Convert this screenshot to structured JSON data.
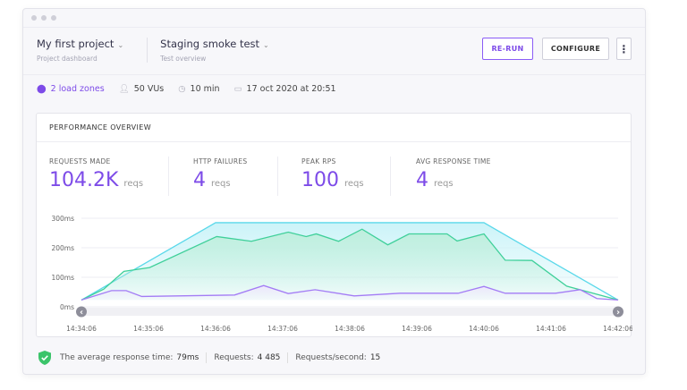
{
  "header": {
    "project": "My first project",
    "project_sub": "Project dashboard",
    "test": "Staging smoke test",
    "test_sub": "Test overview",
    "rerun": "RE-RUN",
    "configure": "CONFIGURE",
    "more": "⋮"
  },
  "meta": {
    "zones": "2 load zones",
    "vus": "50 VUs",
    "duration": "10 min",
    "date": "17 oct 2020 at 20:51"
  },
  "card": {
    "title": "PERFORMANCE OVERVIEW",
    "stats": [
      {
        "label": "REQUESTS MADE",
        "value": "104.2K",
        "unit": "reqs"
      },
      {
        "label": "HTTP FAILURES",
        "value": "4",
        "unit": "reqs"
      },
      {
        "label": "PEAK RPS",
        "value": "100",
        "unit": "reqs"
      },
      {
        "label": "AVG RESPONSE TIME",
        "value": "4",
        "unit": "reqs"
      }
    ]
  },
  "chart_data": {
    "type": "area",
    "ylim": [
      0,
      300
    ],
    "yticks": [
      "0ms",
      "100ms",
      "200ms",
      "300ms"
    ],
    "ytick_values": [
      0,
      100,
      200,
      300
    ],
    "xticks": [
      "14:34:06",
      "14:35:06",
      "14:36:06",
      "14:37:06",
      "14:38:06",
      "14:39:06",
      "14:40:06",
      "14:41:06",
      "14:42:06"
    ],
    "grid": true,
    "series": [
      {
        "color": "#5ad8ea",
        "fill": "#c9f3f8",
        "points": [
          [
            "14:34:06",
            23
          ],
          [
            "14:36:06",
            285
          ],
          [
            "14:40:06",
            285
          ],
          [
            "14:42:06",
            23
          ]
        ]
      },
      {
        "color": "#3fd09a",
        "fill": "#bdeedb",
        "points": [
          [
            "14:34:06",
            23
          ],
          [
            "14:34:26",
            60
          ],
          [
            "14:34:44",
            120
          ],
          [
            "14:35:07",
            133
          ],
          [
            "14:36:07",
            238
          ],
          [
            "14:36:38",
            222
          ],
          [
            "14:37:11",
            253
          ],
          [
            "14:37:27",
            238
          ],
          [
            "14:37:36",
            247
          ],
          [
            "14:37:56",
            222
          ],
          [
            "14:38:17",
            263
          ],
          [
            "14:38:40",
            210
          ],
          [
            "14:38:59",
            247
          ],
          [
            "14:39:33",
            247
          ],
          [
            "14:39:42",
            223
          ],
          [
            "14:40:06",
            247
          ],
          [
            "14:40:25",
            158
          ],
          [
            "14:40:49",
            157
          ],
          [
            "14:41:20",
            70
          ],
          [
            "14:42:06",
            23
          ]
        ]
      },
      {
        "color": "#a37cf5",
        "fill": "#efe7fd",
        "points": [
          [
            "14:34:06",
            23
          ],
          [
            "14:34:33",
            55
          ],
          [
            "14:34:46",
            55
          ],
          [
            "14:35:00",
            35
          ],
          [
            "14:36:23",
            40
          ],
          [
            "14:36:49",
            72
          ],
          [
            "14:37:11",
            45
          ],
          [
            "14:37:35",
            58
          ],
          [
            "14:38:10",
            37
          ],
          [
            "14:38:51",
            46
          ],
          [
            "14:39:43",
            46
          ],
          [
            "14:40:06",
            69
          ],
          [
            "14:40:25",
            46
          ],
          [
            "14:41:10",
            46
          ],
          [
            "14:41:32",
            58
          ],
          [
            "14:41:47",
            28
          ],
          [
            "14:42:06",
            23
          ]
        ]
      }
    ]
  },
  "footer": {
    "avg_label": "The average response time:",
    "avg_value": "79ms",
    "req_label": "Requests:",
    "req_value": "4 485",
    "rps_label": "Requests/second:",
    "rps_value": "15"
  },
  "colors": {
    "accent": "#7d4be8",
    "success": "#3bc46a"
  }
}
